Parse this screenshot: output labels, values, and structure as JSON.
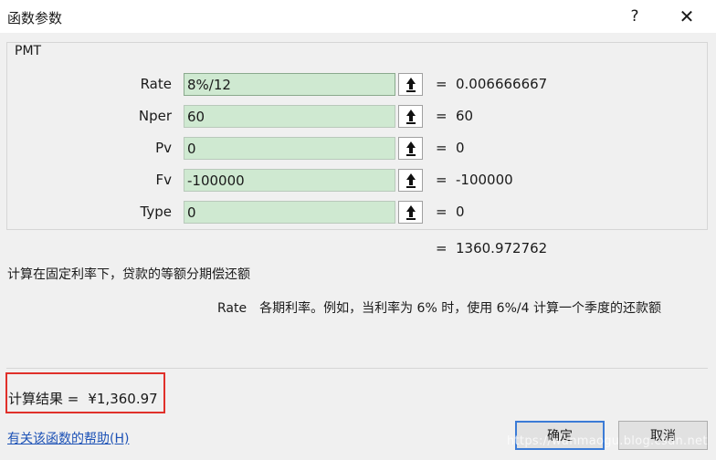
{
  "window": {
    "title": "函数参数",
    "help_glyph": "?",
    "close_glyph": "✕"
  },
  "function_name": "PMT",
  "args": [
    {
      "label": "Rate",
      "value": "8%/12",
      "result": "0.006666667"
    },
    {
      "label": "Nper",
      "value": "60",
      "result": "60"
    },
    {
      "label": "Pv",
      "value": "0",
      "result": "0"
    },
    {
      "label": "Fv",
      "value": "-100000",
      "result": "-100000"
    },
    {
      "label": "Type",
      "value": "0",
      "result": "0"
    }
  ],
  "equals_sign": "=",
  "formula_result": "1360.972762",
  "description": "计算在固定利率下，贷款的等额分期偿还额",
  "arg_help": {
    "name": "Rate",
    "text": "各期利率。例如，当利率为 6% 时，使用 6%/4 计算一个季度的还款额"
  },
  "calc_result": {
    "label": "计算结果 =",
    "value": "¥1,360.97"
  },
  "help_link": "有关该函数的帮助(H)",
  "buttons": {
    "ok": "确定",
    "cancel": "取消"
  },
  "watermark": "https://wanmaogu.blog.csdn.net",
  "icons": {
    "collapse": "collapse-dialog-icon"
  },
  "colors": {
    "input_bg": "#cfe9d1",
    "highlight_box": "#e0302a",
    "link": "#1d52b6",
    "primary_border": "#3b7bd6"
  }
}
